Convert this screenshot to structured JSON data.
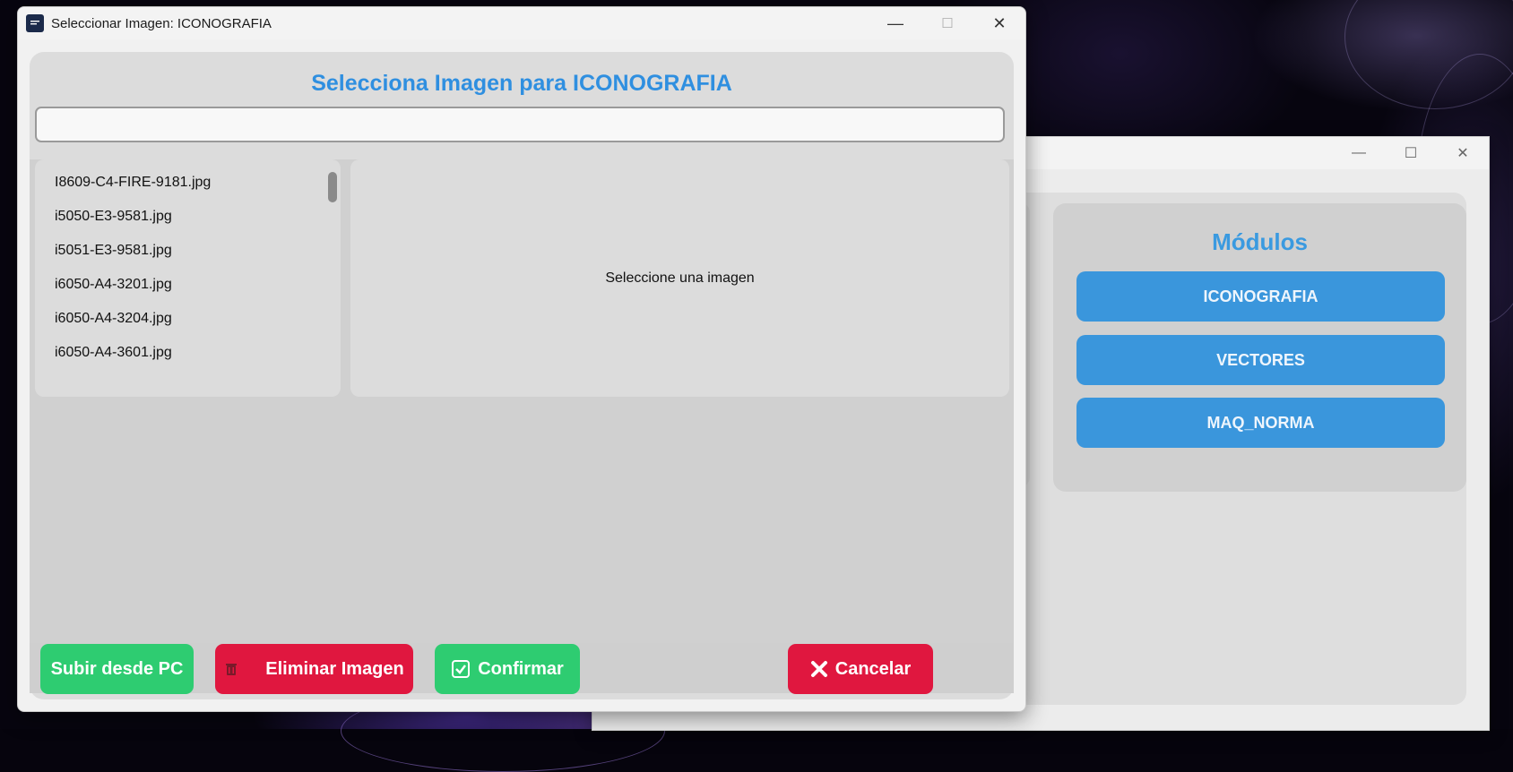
{
  "dialog": {
    "title": "Seleccionar Imagen: ICONOGRAFIA",
    "heading": "Selecciona Imagen para ICONOGRAFIA",
    "search": {
      "value": "",
      "placeholder": ""
    },
    "files": [
      "I8609-C4-FIRE-9181.jpg",
      "i5050-E3-9581.jpg",
      "i5051-E3-9581.jpg",
      "i6050-A4-3201.jpg",
      "i6050-A4-3204.jpg",
      "i6050-A4-3601.jpg"
    ],
    "preview_placeholder": "Seleccione una imagen",
    "buttons": {
      "upload": "Subir desde PC",
      "delete": "Eliminar Imagen",
      "confirm": "Confirmar",
      "cancel": "Cancelar"
    }
  },
  "background_window": {
    "modules_title": "Módulos",
    "modules": [
      "ICONOGRAFIA",
      "VECTORES",
      "MAQ_NORMA"
    ]
  },
  "colors": {
    "accent_blue": "#2f8fe0",
    "module_button": "#3a96dc",
    "green_button": "#2ecc71",
    "red_button": "#e0173f"
  },
  "icons": {
    "app": "app-icon",
    "minimize": "minimize-icon",
    "maximize": "maximize-icon",
    "close": "close-icon",
    "delete": "trash-icon",
    "confirm": "checkbox-icon",
    "cancel": "x-icon"
  }
}
